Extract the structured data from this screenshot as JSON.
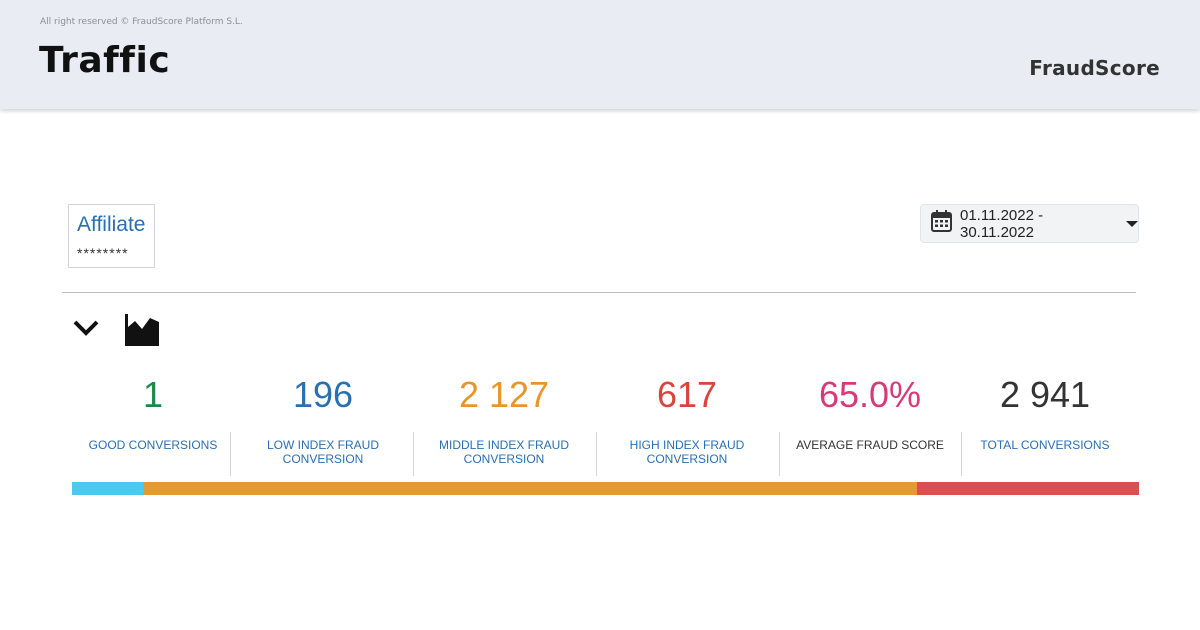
{
  "header": {
    "copyright": "All right reserved © FraudScore Platform S.L.",
    "title": "Traffic",
    "brand": "FraudScore"
  },
  "filters": {
    "affiliate_label": "Affiliate",
    "affiliate_value": "********",
    "date_range": "01.11.2022 - 30.11.2022"
  },
  "toolbar": {
    "collapse_icon": "chevron-down-icon",
    "chart_icon": "area-chart-icon"
  },
  "stats": [
    {
      "value": "1",
      "label": "GOOD CONVERSIONS",
      "color": "#1a8a4a",
      "label_color": "#2a6fb0"
    },
    {
      "value": "196",
      "label": "LOW INDEX FRAUD CONVERSION",
      "color": "#2a6fb0",
      "label_color": "#2a6fb0"
    },
    {
      "value": "2 127",
      "label": "MIDDLE INDEX FRAUD CONVERSION",
      "color": "#e8962a",
      "label_color": "#2a6fb0"
    },
    {
      "value": "617",
      "label": "HIGH INDEX FRAUD CONVERSION",
      "color": "#d9443c",
      "label_color": "#2a6fb0"
    },
    {
      "value": "65.0%",
      "label": "AVERAGE FRAUD SCORE",
      "color": "#d63a78",
      "label_color": "#333333"
    },
    {
      "value": "2 941",
      "label": "TOTAL CONVERSIONS",
      "color": "#333333",
      "label_color": "#2a6fb0"
    }
  ],
  "distribution_bar": [
    {
      "share": 0.0666,
      "color": "#4dc9f0"
    },
    {
      "share": 0.7258,
      "color": "#e39a34"
    },
    {
      "share": 0.2076,
      "color": "#d95050"
    }
  ]
}
